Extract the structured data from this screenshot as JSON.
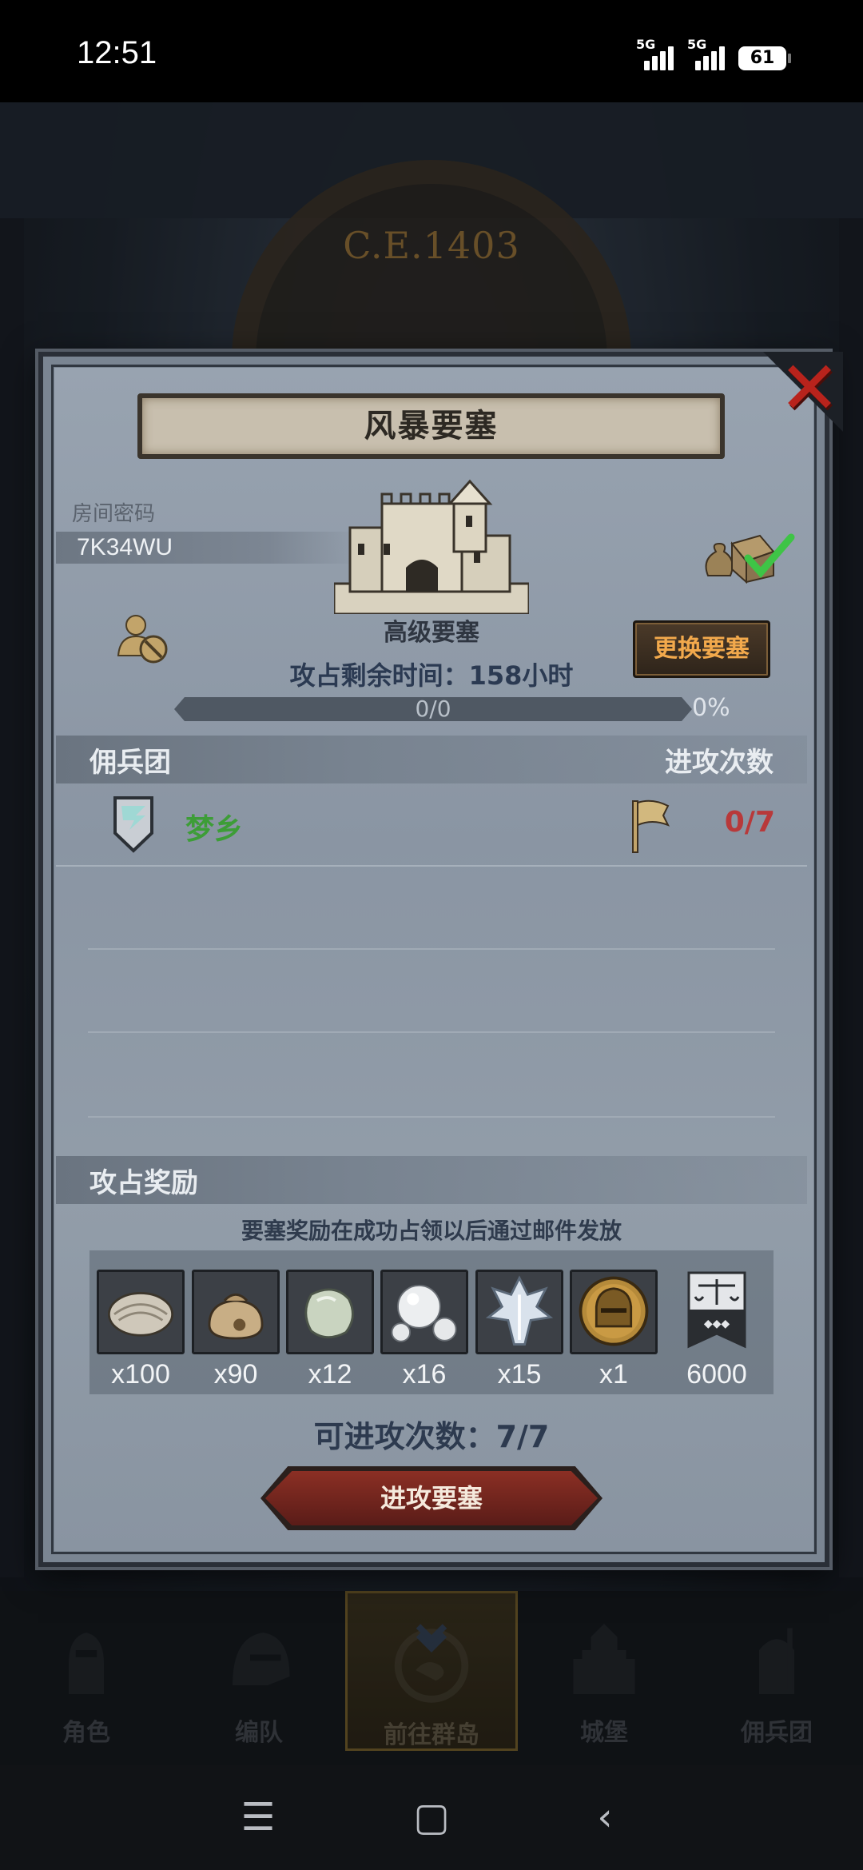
{
  "status_bar": {
    "time": "12:51",
    "network_1": "5G",
    "network_2": "5G",
    "battery": "61"
  },
  "background": {
    "year": "C.E.1403"
  },
  "dialog": {
    "title": "风暴要塞",
    "room_password_label": "房间密码",
    "room_code": "7K34WU",
    "fortress_type": "高级要塞",
    "time_left": "攻占剩余时间：158小时",
    "change_button": "更换要塞",
    "progress_text": "0/0",
    "progress_percent": "0%",
    "progress_fraction": 0,
    "mercenary_header": "佣兵团",
    "attack_count_header": "进攻次数",
    "mercenaries": [
      {
        "name": "梦乡",
        "attacks": "0/7",
        "shield_color": "#9fd8d4",
        "name_color": "#3d9d37"
      }
    ],
    "reward_header": "攻占奖励",
    "reward_note": "要塞奖励在成功占领以后通过邮件发放",
    "rewards": [
      {
        "icon": "oyster-icon",
        "qty": "x100"
      },
      {
        "icon": "sack-icon",
        "qty": "x90"
      },
      {
        "icon": "jade-stone-icon",
        "qty": "x12"
      },
      {
        "icon": "pearls-icon",
        "qty": "x16"
      },
      {
        "icon": "crystal-icon",
        "qty": "x15"
      },
      {
        "icon": "knight-helmet-icon",
        "qty": "x1"
      },
      {
        "icon": "justice-banner-icon",
        "qty": "6000"
      }
    ],
    "available_attacks": "可进攻次数：7/7",
    "attack_button": "进攻要塞"
  },
  "bottom_nav": {
    "items": [
      {
        "label": "角色",
        "icon": "knight-icon"
      },
      {
        "label": "编队",
        "icon": "helmet-icon"
      },
      {
        "label": "前往群岛",
        "icon": "island-compass-icon",
        "active": true
      },
      {
        "label": "城堡",
        "icon": "castle-icon"
      },
      {
        "label": "佣兵团",
        "icon": "mercenary-icon"
      }
    ]
  }
}
